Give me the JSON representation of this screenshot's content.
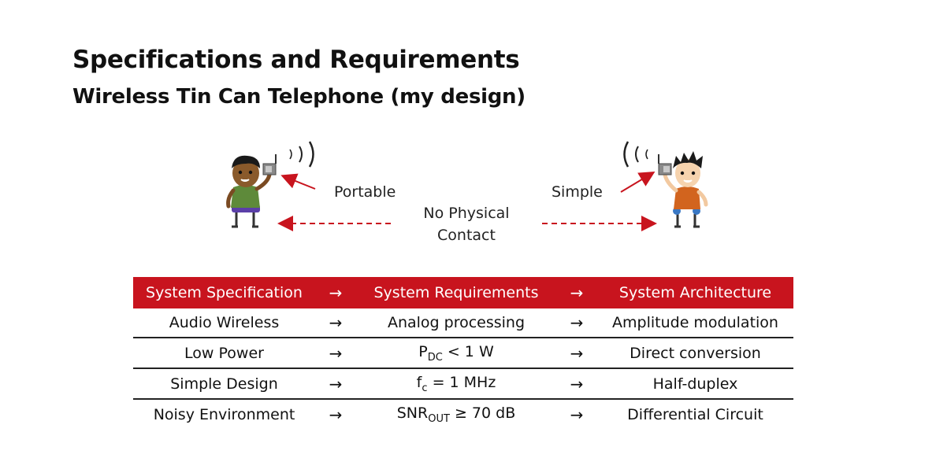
{
  "slide": {
    "title": "Specifications and Requirements",
    "subtitle": "Wireless Tin Can Telephone (my design)"
  },
  "figure": {
    "label_left": "Portable",
    "label_right": "Simple",
    "center_line1": "No Physical",
    "center_line2": "Contact"
  },
  "table": {
    "arrow": "→",
    "headers": [
      "System Specification",
      "System Requirements",
      "System Architecture"
    ],
    "rows": [
      {
        "spec": "Audio Wireless",
        "req": "Analog processing",
        "arch": "Amplitude modulation"
      },
      {
        "spec": "Low Power",
        "req_base": "P",
        "req_sub": "DC",
        "req_tail": " < 1 W",
        "arch": "Direct conversion"
      },
      {
        "spec": "Simple Design",
        "req_base": "f",
        "req_sub": "c",
        "req_tail": " = 1 MHz",
        "arch": "Half-duplex"
      },
      {
        "spec": "Noisy Environment",
        "req_base": "SNR",
        "req_sub": "OUT",
        "req_tail": " ≥ 70 dB",
        "arch": "Differential Circuit"
      }
    ]
  },
  "colors": {
    "header_red": "#c8141e",
    "arrow_red": "#c8141e",
    "left_shirt": "#5e8a3a",
    "right_shirt": "#d2641e"
  }
}
